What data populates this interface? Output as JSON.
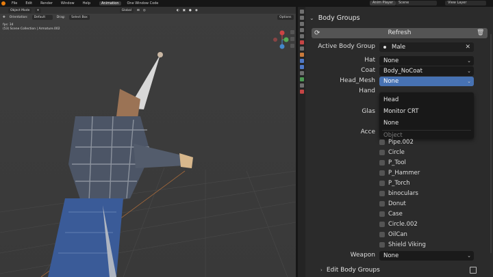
{
  "topbar": {
    "menus": [
      "File",
      "Edit",
      "Render",
      "Window",
      "Help"
    ],
    "tabs": [
      "Animation",
      "One Window Code"
    ],
    "active_tab": "Animation",
    "addon": "Anim Player",
    "scene": "Scene",
    "view_layer": "View Layer"
  },
  "viewport": {
    "mode": "Object Mode",
    "transform": "Global",
    "orientation_label": "Orientation:",
    "orientation_value": "Default",
    "drag_label": "Drag:",
    "drag_value": "Select Box",
    "options": "Options",
    "fps": "fps: 34",
    "collection": "(53) Scene Collection | Armature.002"
  },
  "panel": {
    "title": "Body Groups",
    "refresh": "Refresh",
    "active_body_group_label": "Active Body Group",
    "active_body_group_value": "Male",
    "hat_label": "Hat",
    "hat_value": "None",
    "coat_label": "Coat",
    "coat_value": "Body_NoCoat",
    "head_mesh_label": "Head_Mesh",
    "head_mesh_value": "None",
    "hands_label": "Hand",
    "glasses_label": "Glas",
    "accessories_label": "Acce",
    "dropdown": {
      "items": [
        "Head",
        "Monitor CRT",
        "None"
      ],
      "search_placeholder": "Object"
    },
    "accessories": [
      "Pipe.002",
      "Circle",
      "P_Tool",
      "P_Hammer",
      "P_Torch",
      "binoculars",
      "Donut",
      "Case",
      "Circle.002",
      "OilCan",
      "Shield Viking"
    ],
    "weapon_label": "Weapon",
    "weapon_value": "None",
    "edit_body_groups": "Edit Body Groups"
  },
  "colors": {
    "active_field": "#4772b3",
    "panel_bg": "#2b2b2b",
    "viewport_bg": "#3d3d3d"
  }
}
